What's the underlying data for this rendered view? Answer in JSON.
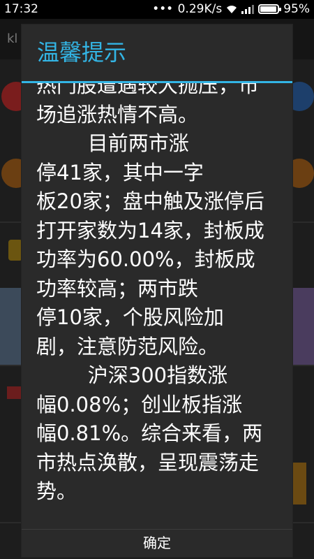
{
  "statusbar": {
    "time": "17:32",
    "dots": "•••",
    "speed": "0.29K/s",
    "battery": "95%",
    "battery_level": 0.95,
    "icons": [
      "wifi-icon",
      "signal-icon",
      "battery-icon"
    ]
  },
  "background": {
    "header_fragment": "kl"
  },
  "dialog": {
    "title": "温馨提示",
    "paragraph": "热门股遭遇较大抛压，市\n场追涨热情不高。\n        目前两市涨\n停41家，其中一字\n板20家；盘中触及涨停后\n打开家数为14家，封板成\n功率为60.00%，封板成\n功率较高；两市跌\n停10家，个股风险加\n剧，注意防范风险。\n        沪深300指数涨\n幅0.08%；创业板指涨\n幅0.81%。综合来看，两\n市热点涣散，呈现震荡走\n势。",
    "ok_label": "确定",
    "accent": "#33b5e5"
  }
}
